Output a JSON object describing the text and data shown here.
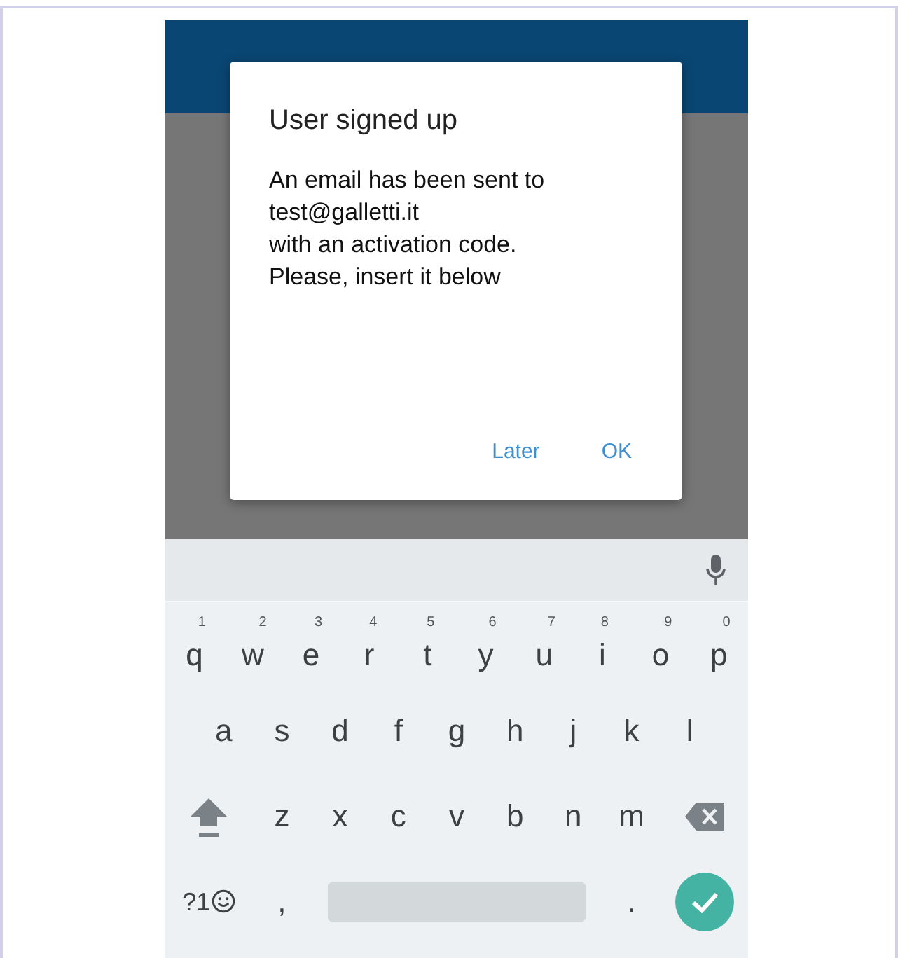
{
  "dialog": {
    "title": "User signed up",
    "message": "An email has been sent to\ntest@galletti.it\nwith an activation code.\nPlease, insert it below",
    "buttons": [
      "Later",
      "OK"
    ]
  },
  "keyboard": {
    "number_row": [
      {
        "label": "q",
        "hint": "1"
      },
      {
        "label": "w",
        "hint": "2"
      },
      {
        "label": "e",
        "hint": "3"
      },
      {
        "label": "r",
        "hint": "4"
      },
      {
        "label": "t",
        "hint": "5"
      },
      {
        "label": "y",
        "hint": "6"
      },
      {
        "label": "u",
        "hint": "7"
      },
      {
        "label": "i",
        "hint": "8"
      },
      {
        "label": "o",
        "hint": "9"
      },
      {
        "label": "p",
        "hint": "0"
      }
    ],
    "middle_row": [
      "a",
      "s",
      "d",
      "f",
      "g",
      "h",
      "j",
      "k",
      "l"
    ],
    "bottom_row": [
      "z",
      "x",
      "c",
      "v",
      "b",
      "n",
      "m"
    ],
    "symbols_key": "?1",
    "comma_key": ",",
    "period_key": "."
  }
}
